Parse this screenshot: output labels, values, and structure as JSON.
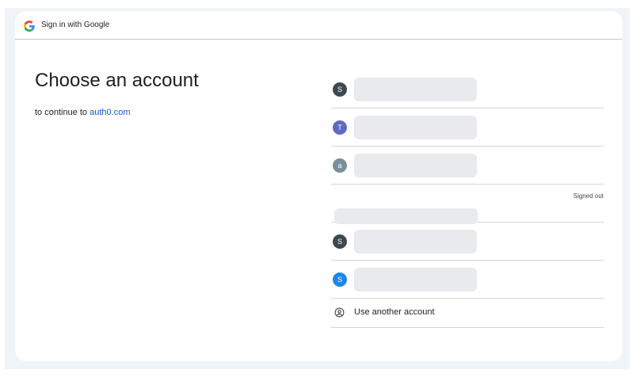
{
  "topbar": {
    "title": "Sign in with Google"
  },
  "main": {
    "heading": "Choose an account",
    "subtitle_prefix": "to continue to",
    "subtitle_link": "auth0.com"
  },
  "accounts": [
    {
      "initial": "S",
      "color": "#3c4a50"
    },
    {
      "initial": "T",
      "color": "#5c6bc0"
    },
    {
      "initial": "a",
      "color": "#78909c"
    },
    {
      "status": "Signed out"
    },
    {
      "initial": "S",
      "color": "#3c4a50"
    },
    {
      "initial": "S",
      "color": "#1e88e5"
    }
  ],
  "use_another": {
    "label": "Use another account",
    "icon": "account-circle-icon"
  },
  "colors": {
    "page_bg": "#f0f4f9",
    "link": "#0b57d0",
    "divider": "#d3d6d9"
  }
}
